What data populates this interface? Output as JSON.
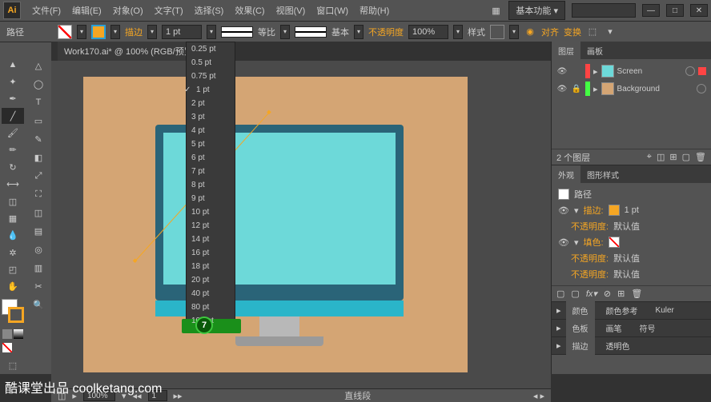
{
  "menubar": {
    "items": [
      "文件(F)",
      "编辑(E)",
      "对象(O)",
      "文字(T)",
      "选择(S)",
      "效果(C)",
      "视图(V)",
      "窗口(W)",
      "帮助(H)"
    ],
    "workspace": "基本功能"
  },
  "controlbar": {
    "selection": "路径",
    "stroke_label": "描边",
    "stroke_weight": "1 pt",
    "uniform": "等比",
    "basic": "基本",
    "opacity_label": "不透明度",
    "opacity_value": "100%",
    "style_label": "样式",
    "align": "对齐",
    "transform": "变换"
  },
  "document": {
    "tab_title": "Work170.ai* @ 100% (RGB/预览)"
  },
  "stroke_dropdown": {
    "items": [
      "0.25 pt",
      "0.5 pt",
      "0.75 pt",
      "1 pt",
      "2 pt",
      "3 pt",
      "4 pt",
      "5 pt",
      "6 pt",
      "7 pt",
      "8 pt",
      "9 pt",
      "10 pt",
      "12 pt",
      "14 pt",
      "16 pt",
      "18 pt",
      "20 pt",
      "40 pt",
      "80 pt",
      "100 pt"
    ],
    "checked_index": 3,
    "badge": "7"
  },
  "layers_panel": {
    "tab1": "图层",
    "tab2": "画板",
    "rows": [
      {
        "name": "Screen",
        "color": "#ff4444"
      },
      {
        "name": "Background",
        "color": "#44ff44"
      }
    ],
    "count": "2 个图层"
  },
  "appearance_panel": {
    "tab1": "外观",
    "tab2": "图形样式",
    "title": "路径",
    "stroke": "描边:",
    "stroke_val": "1 pt",
    "opacity": "不透明度:",
    "opacity_val": "默认值",
    "fill": "填色:"
  },
  "color_panel": {
    "tab1": "颜色",
    "tab2": "颜色参考",
    "tab3": "Kuler"
  },
  "swatch_panel": {
    "tab1": "色板",
    "tab2": "画笔",
    "tab3": "符号"
  },
  "stroke_panel": {
    "tab1": "描边",
    "tab2": "透明色"
  },
  "statusbar": {
    "zoom": "100%",
    "page": "1",
    "tool": "直线段"
  },
  "watermark": "酷课堂出品 coolketang.com"
}
